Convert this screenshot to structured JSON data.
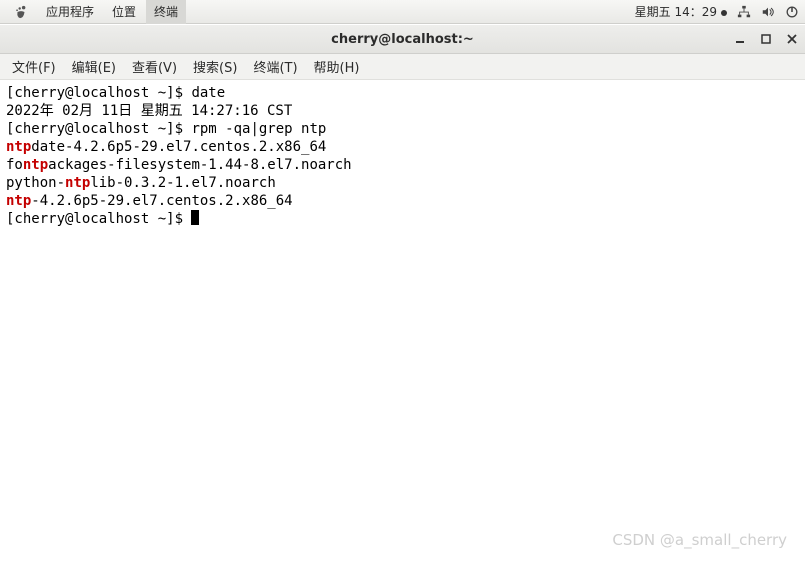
{
  "topbar": {
    "apps": "应用程序",
    "places": "位置",
    "terminal_label": "终端",
    "clock": "星期五 14：29"
  },
  "titlebar": {
    "title": "cherry@localhost:~"
  },
  "menubar": {
    "file": "文件(F)",
    "edit": "编辑(E)",
    "view": "查看(V)",
    "search": "搜索(S)",
    "terminal": "终端(T)",
    "help": "帮助(H)"
  },
  "term": {
    "prompt": "[cherry@localhost ~]$ ",
    "cmd1": "date",
    "out1": "2022年 02月 11日 星期五 14:27:16 CST",
    "cmd2": "rpm -qa|grep ntp",
    "l1_a": "ntp",
    "l1_b": "date-4.2.6p5-29.el7.centos.2.x86_64",
    "l2_a": "fo",
    "l2_b": "ntp",
    "l2_c": "ackages-filesystem-1.44-8.el7.noarch",
    "l3_a": "python-",
    "l3_b": "ntp",
    "l3_c": "lib-0.3.2-1.el7.noarch",
    "l4_a": "ntp",
    "l4_b": "-4.2.6p5-29.el7.centos.2.x86_64"
  },
  "watermark": "CSDN @a_small_cherry"
}
